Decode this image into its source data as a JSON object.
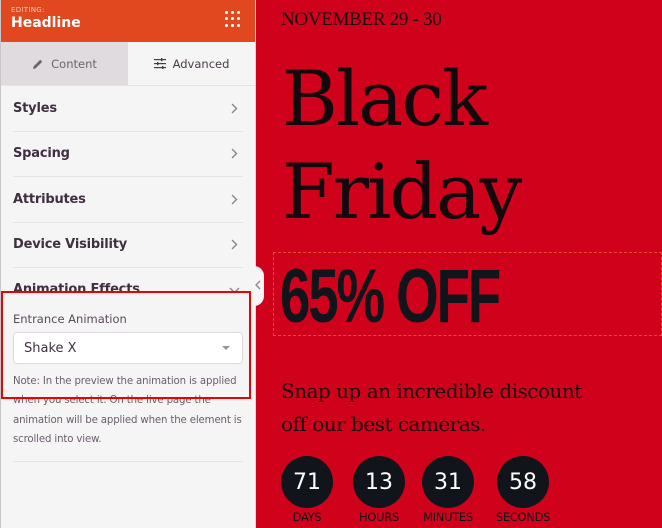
{
  "sidebar": {
    "header": {
      "editing_label": "EDITING:",
      "title": "Headline",
      "menu_icon": "grid-dots-icon"
    },
    "tabs": [
      {
        "label": "Content",
        "icon": "pencil-icon",
        "active": false
      },
      {
        "label": "Advanced",
        "icon": "sliders-icon",
        "active": true
      }
    ],
    "sections": [
      {
        "label": "Styles",
        "icon": "chevron-right-icon"
      },
      {
        "label": "Spacing",
        "icon": "chevron-right-icon"
      },
      {
        "label": "Attributes",
        "icon": "chevron-right-icon"
      },
      {
        "label": "Device Visibility",
        "icon": "chevron-right-icon"
      }
    ],
    "animation": {
      "label": "Animation Effects",
      "icon": "chevron-down-icon",
      "field_label": "Entrance Animation",
      "selected": "Shake X",
      "note": "Note: In the preview the animation is applied when you select it. On the live page the animation will be applied when the element is scrolled into view."
    }
  },
  "canvas": {
    "date": "NOVEMBER 29 - 30",
    "headline_line1": "Black",
    "headline_line2": "Friday",
    "offer": "65% OFF",
    "blurb": "Snap up an incredible discount off our best cameras.",
    "countdown": [
      {
        "value": "71",
        "label": "DAYS"
      },
      {
        "value": "13",
        "label": "HOURS"
      },
      {
        "value": "31",
        "label": "MINUTES"
      },
      {
        "value": "58",
        "label": "SECONDS"
      }
    ]
  },
  "colors": {
    "header": "#e1481f",
    "canvas_bg": "#d0021b",
    "highlight": "#ef0000",
    "dark": "#12141c"
  }
}
